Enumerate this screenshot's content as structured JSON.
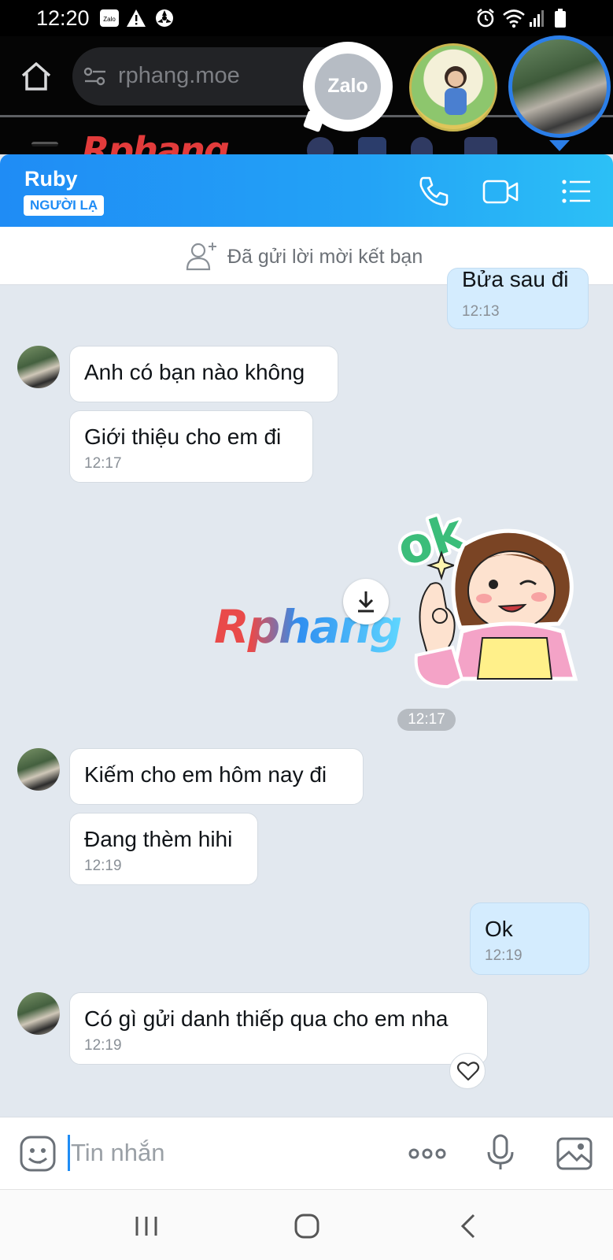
{
  "status_bar": {
    "time": "12:20",
    "zalo_label": "Zalo"
  },
  "browser": {
    "url": "rphang.moe",
    "bg_logo": "Rphang"
  },
  "chat_head": {
    "label": "Zalo"
  },
  "header": {
    "contact_name": "Ruby",
    "stranger_badge": "NGƯỜI LẠ"
  },
  "friend_request": {
    "text": "Đã gửi lời mời kết bạn"
  },
  "messages": [
    {
      "text": "Bửa sau đi",
      "time": "12:13",
      "mine": true
    },
    {
      "text": "Anh có bạn nào không",
      "mine": false
    },
    {
      "text": "Giới thiệu cho em đi",
      "time": "12:17",
      "mine": false
    },
    {
      "sticker": "ok-girl-sticker",
      "sticker_text": "ok",
      "time": "12:17",
      "mine": true
    },
    {
      "text": "Kiếm cho em hôm nay đi",
      "mine": false
    },
    {
      "text": "Đang thèm hihi",
      "time": "12:19",
      "mine": false
    },
    {
      "text": "Ok",
      "time": "12:19",
      "mine": true
    },
    {
      "text": "Có gì gửi danh thiếp qua cho em nha",
      "time": "12:19",
      "mine": false
    }
  ],
  "watermark": "Rphang",
  "input": {
    "placeholder": "Tin nhắn",
    "value": ""
  },
  "colors": {
    "accent": "#1f8cf5",
    "mine_bubble": "#d4ecfe",
    "chat_bg": "#e2e8ef"
  }
}
